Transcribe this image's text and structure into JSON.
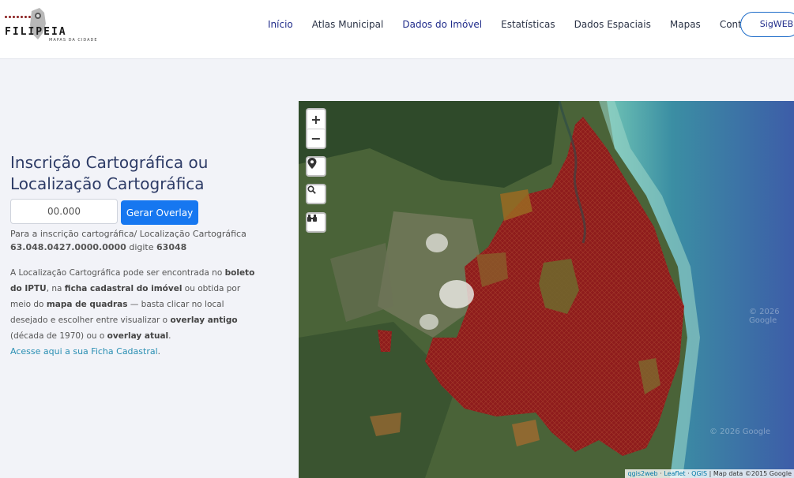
{
  "header": {
    "logo_text": "FILIPEIA",
    "logo_subtitle": "MAPAS DA CIDADE",
    "nav": [
      {
        "label": "Início",
        "active": true
      },
      {
        "label": "Atlas Municipal",
        "active": false
      },
      {
        "label": "Dados do Imóvel",
        "active": true
      },
      {
        "label": "Estatísticas",
        "active": false
      },
      {
        "label": "Dados Espaciais",
        "active": false
      },
      {
        "label": "Mapas",
        "active": false
      },
      {
        "label": "Contato",
        "active": false
      }
    ],
    "sigweb_label": "SigWEB"
  },
  "panel": {
    "title": "Inscrição Cartográfica ou Localização Cartográfica",
    "input_placeholder": "00.000",
    "button_label": "Gerar Overlay",
    "hint_text": "Para a inscrição cartográfica/ Localização Cartográfica",
    "hint_example": "63.048.0427.0000.0000",
    "hint_digite": "digite",
    "hint_code": "63048",
    "desc": {
      "p1": "A Localização Cartográfica pode ser encontrada no",
      "b1": "boleto do IPTU",
      "p2": ", na",
      "b2": "ficha cadastral do imóvel",
      "p3": "ou obtida por meio do",
      "b3": "mapa de quadras",
      "p4": "— basta clicar no local desejado e escolher entre visualizar o",
      "b4": "overlay antigo",
      "p5": "(década de 1970) ou o",
      "b5": "overlay atual",
      "p6": ".",
      "link": "Acesse aqui a sua Ficha Cadastral"
    }
  },
  "map": {
    "zoom_in": "+",
    "zoom_out": "−",
    "attribution": {
      "qgis2web": "qgis2web",
      "leaflet": "Leaflet",
      "qgis": "QGIS",
      "mapdata": "Map data ©2015 Google"
    },
    "watermark": "© 2026 Google"
  }
}
